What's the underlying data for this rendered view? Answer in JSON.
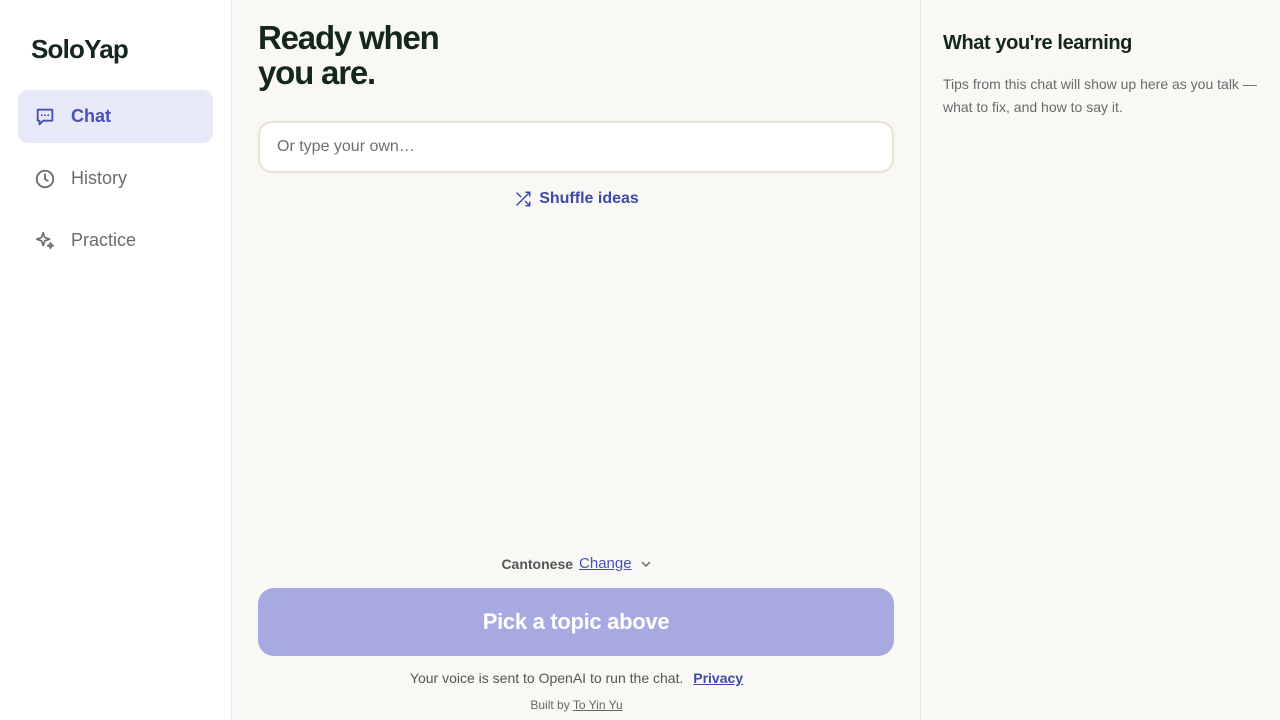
{
  "brand": "SoloYap",
  "nav": [
    {
      "label": "Chat",
      "icon": "chat-bubble-icon",
      "active": true
    },
    {
      "label": "History",
      "icon": "clock-icon",
      "active": false
    },
    {
      "label": "Practice",
      "icon": "sparkles-icon",
      "active": false
    }
  ],
  "main": {
    "headline": "Ready when\nyou are.",
    "input_placeholder": "Or type your own…",
    "shuffle_label": "Shuffle ideas",
    "language": "Cantonese",
    "change_label": "Change",
    "start_button": "Pick a topic above",
    "disclaimer": "Your voice is sent to OpenAI to run the chat.",
    "privacy_link": "Privacy",
    "credit_prefix": "Built by",
    "credit_name": "To Yin Yu"
  },
  "learning": {
    "title": "What you're learning",
    "description": "Tips from this chat will show up here as you talk — what to fix, and how to say it."
  },
  "colors": {
    "accent": "#4752b3",
    "button_disabled": "#a6aae0",
    "active_nav_bg": "#e7e8f8",
    "background": "#f9f8f5"
  }
}
